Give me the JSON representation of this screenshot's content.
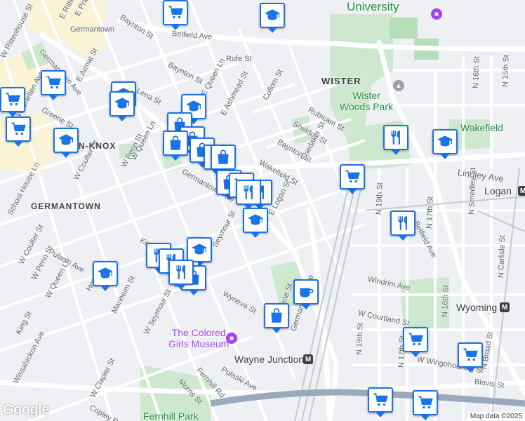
{
  "street_labels": [
    {
      "text": "E Rittenhouse St"
    },
    {
      "text": "E Price St"
    },
    {
      "text": "Baynton St"
    },
    {
      "text": "Germantown"
    },
    {
      "text": "W Rittenhouse St"
    },
    {
      "text": "Germantown Ave"
    },
    {
      "text": "E Armat St"
    },
    {
      "text": "Belfield Ave"
    },
    {
      "text": "Rufe St"
    },
    {
      "text": "Lena St"
    },
    {
      "text": "Baynton St"
    },
    {
      "text": "E Queen Ln"
    },
    {
      "text": "E Ashmead St"
    },
    {
      "text": "Collom St"
    },
    {
      "text": "W Chelten Ave"
    },
    {
      "text": "Greene St"
    },
    {
      "text": "Rubicam St"
    },
    {
      "text": "Sheldon St"
    },
    {
      "text": "Baynton St"
    },
    {
      "text": "Shedaker St"
    },
    {
      "text": "Wakefield St"
    },
    {
      "text": "W Penn St"
    },
    {
      "text": "W Coulter St"
    },
    {
      "text": "W Queen Ln"
    },
    {
      "text": "Germantown Ave"
    },
    {
      "text": "Lindley Ave"
    },
    {
      "text": "N 16th St"
    },
    {
      "text": "N 15th St"
    },
    {
      "text": "E Logan St"
    },
    {
      "text": "N 19th St"
    },
    {
      "text": "Belfield Ave"
    },
    {
      "text": "N Smedley St"
    },
    {
      "text": "N 17th St"
    },
    {
      "text": "Pulaski Ave"
    },
    {
      "text": "W Coulter St"
    },
    {
      "text": "W Penn St"
    },
    {
      "text": "W Queen Ln"
    },
    {
      "text": "Seymour St"
    },
    {
      "text": "Keyser St"
    },
    {
      "text": "Windrim Ave"
    },
    {
      "text": "Manheim St"
    },
    {
      "text": "Wyneva St"
    },
    {
      "text": "W Seymour St"
    },
    {
      "text": "King St"
    },
    {
      "text": "W Courtland St"
    },
    {
      "text": "N 16th St"
    },
    {
      "text": "N Carlisle St"
    },
    {
      "text": "N 19th St"
    },
    {
      "text": "W Wingohocking St"
    },
    {
      "text": "Blavis St"
    },
    {
      "text": "N Broad St"
    },
    {
      "text": "Wissahickon Ave"
    },
    {
      "text": "W Clapier St"
    },
    {
      "text": "Pulaski Ave"
    },
    {
      "text": "Morris St"
    },
    {
      "text": "Fernhill Rd"
    },
    {
      "text": "Copley Rd"
    },
    {
      "text": "Germantown Ave"
    },
    {
      "text": "Hood St"
    },
    {
      "text": "School House Ln"
    },
    {
      "text": "Greene St"
    },
    {
      "text": "N 17th St"
    }
  ],
  "area_labels": [
    {
      "text": "WISTER"
    },
    {
      "text": "GERMANTOWN"
    },
    {
      "text": "N-KNOX"
    }
  ],
  "poi_labels": [
    {
      "text": "University",
      "kind": "green"
    },
    {
      "text": "Wister\nWoods Park",
      "kind": "green"
    },
    {
      "text": "Wakefield",
      "kind": "green"
    },
    {
      "text": "The Colored\nGirls Museum",
      "kind": "purple"
    },
    {
      "text": "Wayne Junction",
      "kind": "dark"
    },
    {
      "text": "Fernhill Park",
      "kind": "green"
    },
    {
      "text": "Logan",
      "kind": "dark"
    },
    {
      "text": "Wyoming",
      "kind": "dark"
    }
  ],
  "pins": [
    {
      "icon": "cart"
    },
    {
      "icon": "school"
    },
    {
      "icon": "cart"
    },
    {
      "icon": "cart"
    },
    {
      "icon": "cart"
    },
    {
      "icon": "school"
    },
    {
      "icon": "school"
    },
    {
      "icon": "school"
    },
    {
      "icon": "school"
    },
    {
      "icon": "bag"
    },
    {
      "icon": "bag"
    },
    {
      "icon": "bag"
    },
    {
      "icon": "bag"
    },
    {
      "icon": "bag"
    },
    {
      "icon": "bag"
    },
    {
      "icon": "bag"
    },
    {
      "icon": "cart"
    },
    {
      "icon": "fork"
    },
    {
      "icon": "fork"
    },
    {
      "icon": "school"
    },
    {
      "icon": "school"
    },
    {
      "icon": "fork"
    },
    {
      "icon": "fork"
    },
    {
      "icon": "bag"
    },
    {
      "icon": "bag"
    },
    {
      "icon": "fork"
    },
    {
      "icon": "cart"
    },
    {
      "icon": "fork"
    },
    {
      "icon": "school"
    },
    {
      "icon": "fork"
    },
    {
      "icon": "bag"
    },
    {
      "icon": "cup"
    },
    {
      "icon": "cart"
    },
    {
      "icon": "cart"
    },
    {
      "icon": "cart"
    },
    {
      "icon": "school"
    },
    {
      "icon": "cart"
    }
  ],
  "transit": [
    {
      "label": "M"
    },
    {
      "label": "M"
    },
    {
      "label": "M"
    }
  ],
  "branding": {
    "logo": "Google",
    "attribution": "Map data ©2025"
  },
  "colors": {
    "pin_border": "#1a73e8",
    "park": "#c8e6c9",
    "road": "#ffffff",
    "rail": "#bdc1c6"
  }
}
